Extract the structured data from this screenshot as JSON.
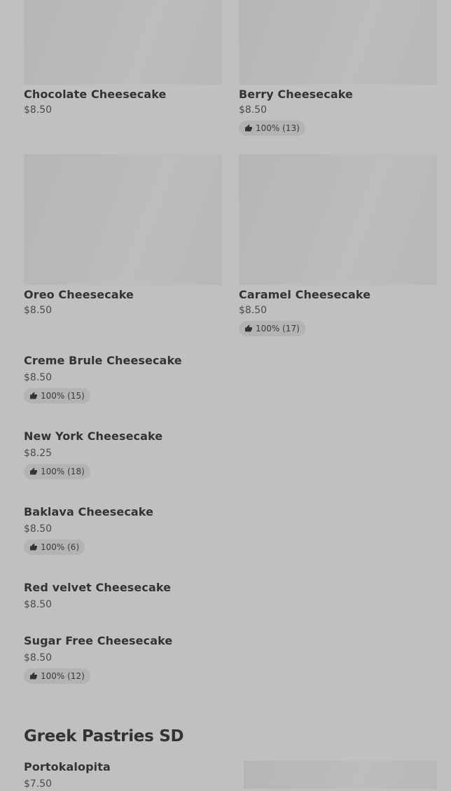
{
  "items": [
    {
      "name": "Chocolate Cheesecake",
      "price": "$8.50",
      "rating": ""
    },
    {
      "name": "Berry Cheesecake",
      "price": "$8.50",
      "rating": "100% (13)"
    },
    {
      "name": "Oreo Cheesecake",
      "price": "$8.50",
      "rating": ""
    },
    {
      "name": "Caramel Cheesecake",
      "price": "$8.50",
      "rating": "100% (17)"
    },
    {
      "name": "Creme Brule Cheesecake",
      "price": "$8.50",
      "rating": "100% (15)"
    },
    {
      "name": "New York Cheesecake",
      "price": "$8.25",
      "rating": "100% (18)"
    },
    {
      "name": "Baklava Cheesecake",
      "price": "$8.50",
      "rating": "100% (6)"
    },
    {
      "name": "Red velvet Cheesecake",
      "price": "$8.50",
      "rating": ""
    },
    {
      "name": "Sugar Free Cheesecake",
      "price": "$8.50",
      "rating": "100% (12)"
    }
  ],
  "section2": {
    "title": "Greek Pastries SD",
    "first_item": {
      "name": "Portokalopita",
      "price": "$7.50"
    }
  },
  "icons": {
    "rating": "thumbs-up-icon"
  },
  "colors": {
    "page_background": "#c0c0c0",
    "image_placeholder": "#b8b8b8",
    "rating_pill": "#b3b3b3"
  }
}
